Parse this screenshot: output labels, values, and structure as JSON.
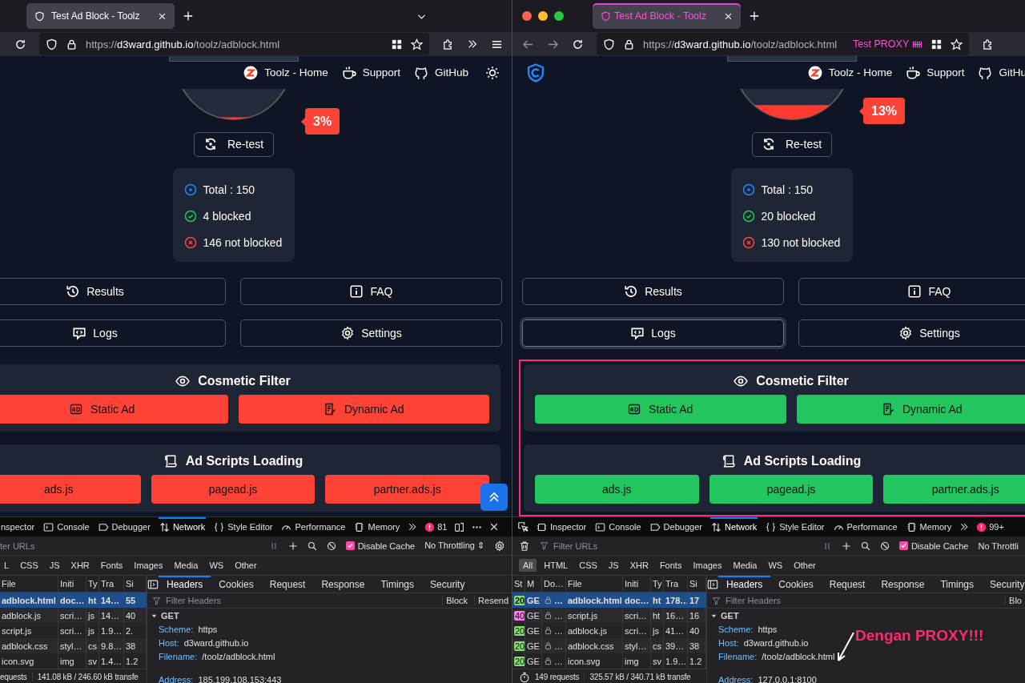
{
  "panes": [
    {
      "tab": {
        "title": "Test Ad Block - Toolz",
        "selected": true
      },
      "tab_list_button": true,
      "url": "https://d3ward.github.io/toolz/adblock.html",
      "overflow_menu": true,
      "nav_links": [
        {
          "kind": "home",
          "label": "Toolz - Home"
        },
        {
          "kind": "support",
          "label": "Support"
        },
        {
          "kind": "github",
          "label": "GitHub"
        }
      ],
      "theme_toggle": true,
      "score": {
        "percent": "3%",
        "level": 0.03
      },
      "retest": "Re-test",
      "stats": [
        {
          "kind": "total",
          "text": "Total : 150"
        },
        {
          "kind": "blocked",
          "text": "4 blocked"
        },
        {
          "kind": "not_blocked",
          "text": "146 not blocked"
        }
      ],
      "menu": [
        {
          "kind": "results",
          "label": "Results",
          "focused": false
        },
        {
          "kind": "faq",
          "label": "FAQ",
          "focused": false
        },
        {
          "kind": "logs",
          "label": "Logs",
          "focused": false
        },
        {
          "kind": "settings",
          "label": "Settings",
          "focused": false
        }
      ],
      "sections": [
        {
          "kind": "cosmetic",
          "title": "Cosmetic Filter",
          "items": [
            {
              "kind": "static",
              "label": "Static Ad",
              "blocked": false
            },
            {
              "kind": "dynamic",
              "label": "Dynamic Ad",
              "blocked": false
            }
          ]
        },
        {
          "kind": "scripts",
          "title": "Ad Scripts Loading",
          "items": [
            {
              "kind": "script",
              "label": "ads.js",
              "blocked": false
            },
            {
              "kind": "script",
              "label": "pagead.js",
              "blocked": false
            },
            {
              "kind": "script",
              "label": "partner.ads.js",
              "blocked": false
            }
          ]
        }
      ],
      "scroll_top": true,
      "devtools": {
        "tabs": [
          {
            "kind": "inspector",
            "label": "nspector",
            "selected": false
          },
          {
            "kind": "console",
            "label": "Console",
            "selected": false
          },
          {
            "kind": "debugger",
            "label": "Debugger",
            "selected": false
          },
          {
            "kind": "network",
            "label": "Network",
            "selected": true
          },
          {
            "kind": "style",
            "label": "Style Editor",
            "selected": false
          },
          {
            "kind": "performance",
            "label": "Performance",
            "selected": false
          },
          {
            "kind": "memory",
            "label": "Memory",
            "selected": false
          }
        ],
        "error_count": "81",
        "window_controls": true,
        "filter_placeholder": "ter URLs",
        "disable_cache": {
          "label": "Disable Cache",
          "checked": true
        },
        "throttling": "No Throttling ⇕",
        "settings_button": true,
        "types": [
          {
            "label": "L",
            "selected": false
          },
          {
            "label": "CSS",
            "selected": false
          },
          {
            "label": "JS",
            "selected": false
          },
          {
            "label": "XHR",
            "selected": false
          },
          {
            "label": "Fonts",
            "selected": false
          },
          {
            "label": "Images",
            "selected": false
          },
          {
            "label": "Media",
            "selected": false
          },
          {
            "label": "WS",
            "selected": false
          },
          {
            "label": "Other",
            "selected": false
          }
        ],
        "columns": [
          "File",
          "Initi",
          "Ty",
          "Tra",
          "Si"
        ],
        "rows": [
          {
            "selected": true,
            "cells": [
              "adblock.html",
              "doc…",
              "ht",
              "14…",
              "55"
            ]
          },
          {
            "selected": false,
            "cells": [
              "adblock.js",
              "scri…",
              "js",
              "14…",
              "40"
            ]
          },
          {
            "selected": false,
            "cells": [
              "script.js",
              "scri…",
              "js",
              "1.9…",
              "2."
            ]
          },
          {
            "selected": false,
            "cells": [
              "adblock.css",
              "styl…",
              "cs",
              "9.8…",
              "38"
            ]
          },
          {
            "selected": false,
            "cells": [
              "icon.svg",
              "img",
              "sv",
              "1.4…",
              "1.2"
            ]
          }
        ],
        "panel_tabs": [
          {
            "label": "Headers",
            "selected": true
          },
          {
            "label": "Cookies",
            "selected": false
          },
          {
            "label": "Request",
            "selected": false
          },
          {
            "label": "Response",
            "selected": false
          },
          {
            "label": "Timings",
            "selected": false
          },
          {
            "label": "Security",
            "selected": false
          }
        ],
        "filter_headers_placeholder": "Filter Headers",
        "actions": [
          "Block",
          "Resend"
        ],
        "method": "GET",
        "fields": [
          {
            "name": "Scheme:",
            "value": "https"
          },
          {
            "name": "Host:",
            "value": "d3ward.github.io"
          },
          {
            "name": "Filename:",
            "value": "/toolz/adblock.html"
          }
        ],
        "address": {
          "name": "Address:",
          "value": "185.199.108.153:443"
        },
        "status": [
          "equests",
          "141.08 kB / 246.60 kB transfe"
        ]
      }
    },
    {
      "traffic_lights": true,
      "tab": {
        "title": "Test Ad Block - Toolz",
        "selected": true
      },
      "nav_arrows": true,
      "url": "https://d3ward.github.io/toolz/adblock.html",
      "proxy_label": "Test PROXY",
      "logo": true,
      "nav_links": [
        {
          "kind": "home",
          "label": "Toolz - Home"
        },
        {
          "kind": "support",
          "label": "Support"
        },
        {
          "kind": "github",
          "label": "GitHu"
        }
      ],
      "score": {
        "percent": "13%",
        "level": 0.13
      },
      "retest": "Re-test",
      "stats": [
        {
          "kind": "total",
          "text": "Total : 150"
        },
        {
          "kind": "blocked",
          "text": "20 blocked"
        },
        {
          "kind": "not_blocked",
          "text": "130 not blocked"
        }
      ],
      "menu": [
        {
          "kind": "results",
          "label": "Results",
          "focused": false
        },
        {
          "kind": "faq",
          "label": "FAQ",
          "focused": false
        },
        {
          "kind": "logs",
          "label": "Logs",
          "focused": true
        },
        {
          "kind": "settings",
          "label": "Settings",
          "focused": false
        }
      ],
      "highlighted": true,
      "sections": [
        {
          "kind": "cosmetic",
          "title": "Cosmetic Filter",
          "items": [
            {
              "kind": "static",
              "label": "Static Ad",
              "blocked": true
            },
            {
              "kind": "dynamic",
              "label": "Dynamic Ad",
              "blocked": true
            }
          ]
        },
        {
          "kind": "scripts",
          "title": "Ad Scripts Loading",
          "items": [
            {
              "kind": "script",
              "label": "ads.js",
              "blocked": true
            },
            {
              "kind": "script",
              "label": "pagead.js",
              "blocked": true
            },
            {
              "kind": "script",
              "label": "partner.ads.js",
              "blocked": true
            }
          ]
        }
      ],
      "devtools": {
        "element_picker": true,
        "tabs": [
          {
            "kind": "inspector",
            "label": "Inspector",
            "selected": false
          },
          {
            "kind": "console",
            "label": "Console",
            "selected": false
          },
          {
            "kind": "debugger",
            "label": "Debugger",
            "selected": false
          },
          {
            "kind": "network",
            "label": "Network",
            "selected": true
          },
          {
            "kind": "style",
            "label": "Style Editor",
            "selected": false
          },
          {
            "kind": "performance",
            "label": "Performance",
            "selected": false
          },
          {
            "kind": "memory",
            "label": "Memory",
            "selected": false
          }
        ],
        "error_count": "99+",
        "clear_button": true,
        "filter_placeholder": "Filter URLs",
        "disable_cache": {
          "label": "Disable Cache",
          "checked": true
        },
        "throttling": "No Throttli",
        "types": [
          {
            "label": "All",
            "selected": true
          },
          {
            "label": "HTML",
            "selected": false
          },
          {
            "label": "CSS",
            "selected": false
          },
          {
            "label": "JS",
            "selected": false
          },
          {
            "label": "XHR",
            "selected": false
          },
          {
            "label": "Fonts",
            "selected": false
          },
          {
            "label": "Images",
            "selected": false
          },
          {
            "label": "Media",
            "selected": false
          },
          {
            "label": "WS",
            "selected": false
          },
          {
            "label": "Other",
            "selected": false
          }
        ],
        "columns": [
          "St",
          "M",
          "Do…",
          "File",
          "Initi",
          "Ty",
          "Tra",
          "Si"
        ],
        "rows": [
          {
            "selected": true,
            "cells": [
              {
                "kind": "status",
                "text": "20",
                "color": "#86de74"
              },
              "GE",
              {
                "kind": "lock",
                "text": "…"
              },
              "adblock.html",
              "doc…",
              "ht",
              "178…",
              "17"
            ]
          },
          {
            "selected": false,
            "cells": [
              {
                "kind": "status",
                "text": "40",
                "color": "#ff7de9"
              },
              "GE",
              {
                "kind": "lock",
                "text": "…"
              },
              "script.js",
              "scri…",
              "ht",
              "16…",
              "16"
            ]
          },
          {
            "selected": false,
            "cells": [
              {
                "kind": "status",
                "text": "20",
                "color": "#86de74"
              },
              "GE",
              {
                "kind": "lock",
                "text": "…"
              },
              "adblock.js",
              "scri…",
              "js",
              "41…",
              "40"
            ]
          },
          {
            "selected": false,
            "cells": [
              {
                "kind": "status",
                "text": "20",
                "color": "#86de74"
              },
              "GE",
              {
                "kind": "lock",
                "text": "…"
              },
              "adblock.css",
              "styl…",
              "cs",
              "39…",
              "38"
            ]
          },
          {
            "selected": false,
            "cells": [
              {
                "kind": "status",
                "text": "20",
                "color": "#86de74"
              },
              "GE",
              {
                "kind": "lock",
                "text": "…"
              },
              "icon.svg",
              "img",
              "sv",
              "1.9…",
              "1.2"
            ]
          }
        ],
        "panel_tabs": [
          {
            "label": "Headers",
            "selected": true
          },
          {
            "label": "Cookies",
            "selected": false
          },
          {
            "label": "Request",
            "selected": false
          },
          {
            "label": "Response",
            "selected": false
          },
          {
            "label": "Timings",
            "selected": false
          },
          {
            "label": "Security",
            "selected": false
          }
        ],
        "filter_headers_placeholder": "Filter Headers",
        "actions": [
          "Blo"
        ],
        "method": "GET",
        "fields": [
          {
            "name": "Scheme:",
            "value": "https"
          },
          {
            "name": "Host:",
            "value": "d3ward.github.io"
          },
          {
            "name": "Filename:",
            "value": "/toolz/adblock.html"
          }
        ],
        "address": {
          "name": "Address:",
          "value": "127.0.0.1:8100"
        },
        "timer": true,
        "status": [
          "149 requests",
          "325.57 kB / 340.71 kB transfe"
        ]
      },
      "annotation": "Dengan PROXY!!!"
    }
  ]
}
